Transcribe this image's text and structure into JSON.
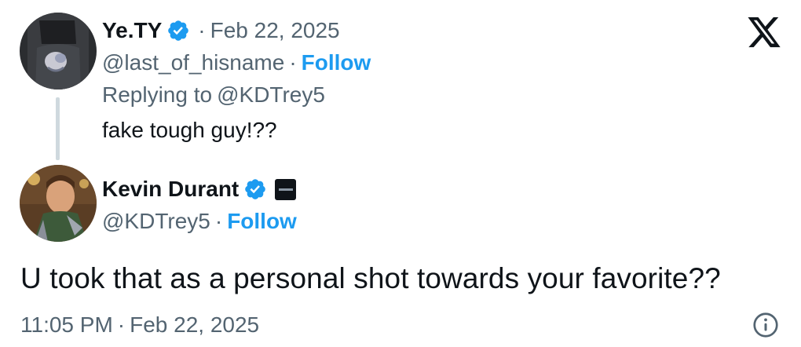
{
  "reply_tweet": {
    "author_name": "Ye.TY",
    "dot": "·",
    "date": "Feb 22, 2025",
    "handle": "@last_of_hisname",
    "follow_sep": "·",
    "follow_label": "Follow",
    "replying_prefix": "Replying to",
    "replying_handle": "@KDTrey5",
    "text": "fake tough guy!??"
  },
  "main_tweet": {
    "author_name": "Kevin Durant",
    "handle": "@KDTrey5",
    "follow_sep": "·",
    "follow_label": "Follow",
    "text": "U took that as a personal shot towards your favorite??",
    "time": "11:05 PM",
    "time_sep": "·",
    "date": "Feb 22, 2025"
  },
  "colors": {
    "accent": "#1d9bf0",
    "muted": "#536471",
    "text": "#0f1419",
    "thread_line": "#cfd9de"
  },
  "icons": {
    "logo": "x-logo-icon",
    "verified": "verified-badge-icon",
    "info": "info-icon",
    "affiliation": "affiliation-badge-icon"
  }
}
